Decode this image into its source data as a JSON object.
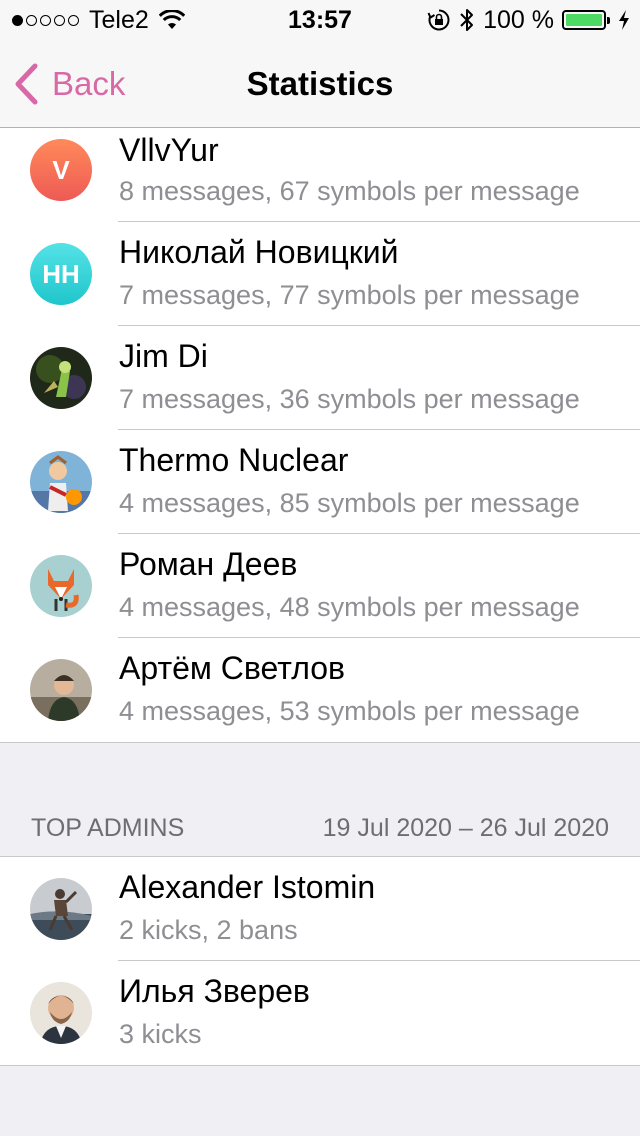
{
  "status_bar": {
    "carrier": "Tele2",
    "time": "13:57",
    "battery": "100 %"
  },
  "nav": {
    "back_label": "Back",
    "title": "Statistics"
  },
  "top_posters": [
    {
      "name": "VllvYur",
      "subtitle": "8 messages, 67 symbols per message",
      "initials": "V",
      "avatar_color": "#f2704e"
    },
    {
      "name": "Николай Новицкий",
      "subtitle": "7 messages, 77 symbols per message",
      "initials": "НН",
      "avatar_color": "#2bd3d7"
    },
    {
      "name": "Jim Di",
      "subtitle": "7 messages, 36 symbols per message"
    },
    {
      "name": "Thermo Nuclear",
      "subtitle": "4 messages, 85 symbols per message"
    },
    {
      "name": "Роман Деев",
      "subtitle": "4 messages, 48 symbols per message"
    },
    {
      "name": "Артём Светлов",
      "subtitle": "4 messages, 53 symbols per message"
    }
  ],
  "admins_section": {
    "title": "TOP ADMINS",
    "range": "19 Jul 2020 – 26 Jul 2020"
  },
  "top_admins": [
    {
      "name": "Alexander Istomin",
      "subtitle": "2 kicks, 2 bans"
    },
    {
      "name": "Илья Зверев",
      "subtitle": "3 kicks"
    }
  ],
  "colors": {
    "accent": "#d869a6",
    "battery": "#4cd964",
    "secondary_text": "#8e8e93"
  }
}
